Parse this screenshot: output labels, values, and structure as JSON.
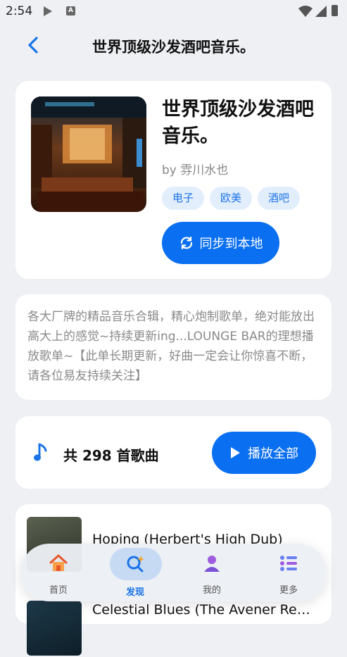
{
  "status_bar": {
    "time": "2:54"
  },
  "header": {
    "title": "世界顶级沙发酒吧音乐。"
  },
  "playlist": {
    "title": "世界顶级沙发酒吧音乐。",
    "author": "by 雰川水也",
    "tags": [
      "电子",
      "欧美",
      "酒吧"
    ],
    "sync_label": "同步到本地",
    "description": "各大厂牌的精品音乐合辑，精心炮制歌单，绝对能放出高大上的感觉~持续更新ing...LOUNGE BAR的理想播放歌单~【此单长期更新，好曲一定会让你惊喜不断，请各位易友持续关注】",
    "count_label": "共 298 首歌曲",
    "play_all_label": "播放全部"
  },
  "songs": [
    {
      "title": "Hoping (Herbert's High Dub)"
    },
    {
      "title": "Celestial Blues (The Avener Rework)"
    }
  ],
  "tabbar": {
    "items": [
      {
        "label": "首页",
        "icon": "home-icon"
      },
      {
        "label": "发现",
        "icon": "discover-icon",
        "active": true
      },
      {
        "label": "我的",
        "icon": "user-icon"
      },
      {
        "label": "更多",
        "icon": "more-list-icon"
      }
    ]
  },
  "colors": {
    "accent": "#0a6ff0",
    "tag_bg": "#e3eefc",
    "background": "#eef0f4"
  }
}
